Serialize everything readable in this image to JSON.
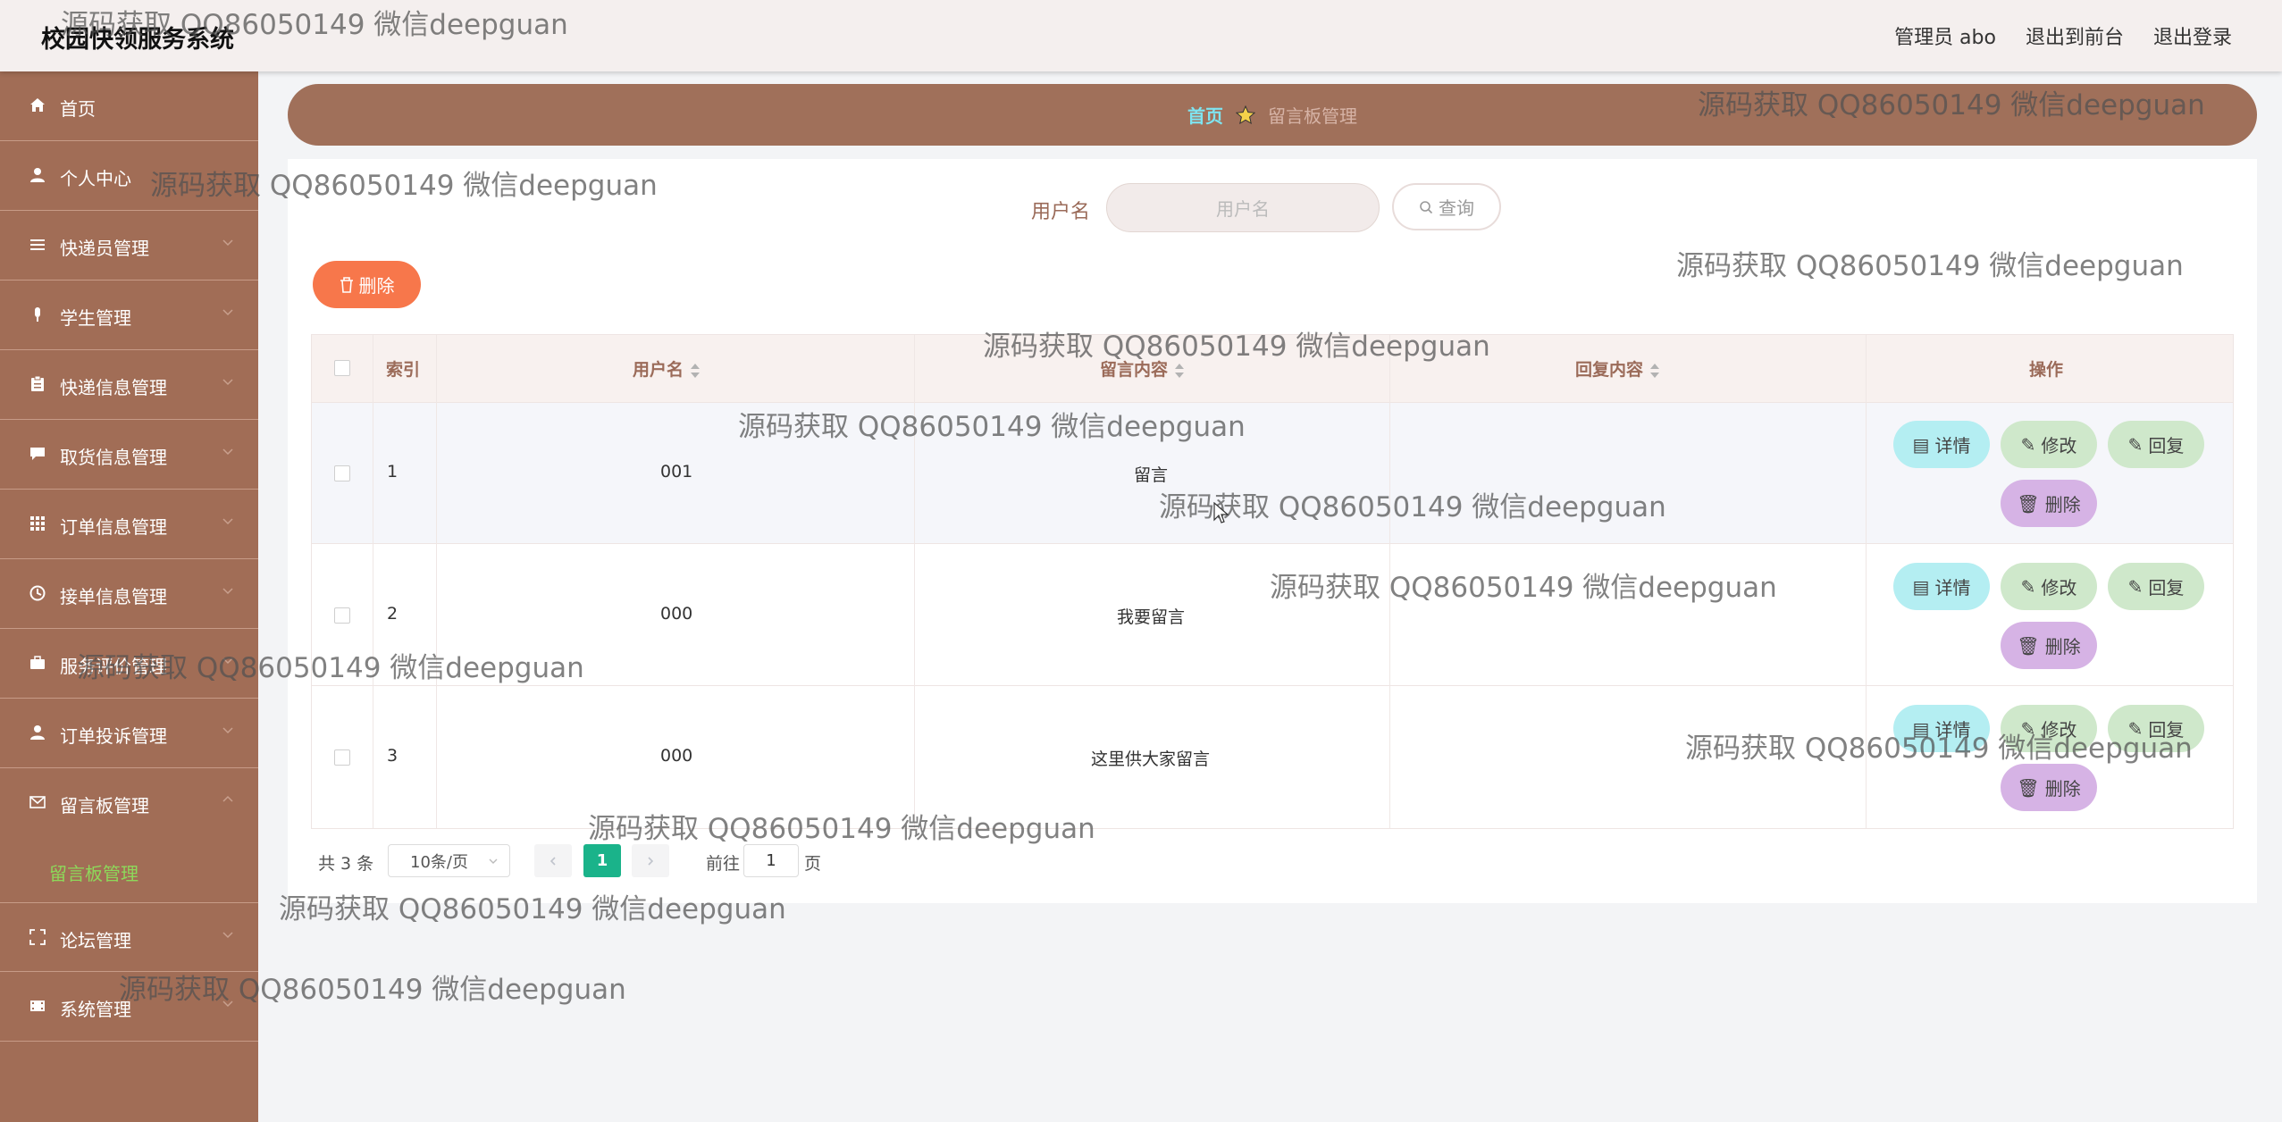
{
  "app": {
    "title": "校园快领服务系统"
  },
  "header": {
    "user": "管理员 abo",
    "to_front": "退出到前台",
    "logout": "退出登录"
  },
  "sidebar": {
    "items": [
      {
        "label": "首页",
        "icon": "home-icon"
      },
      {
        "label": "个人中心",
        "icon": "user-icon"
      },
      {
        "label": "快递员管理",
        "icon": "list-icon"
      },
      {
        "label": "学生管理",
        "icon": "microphone-icon"
      },
      {
        "label": "快递信息管理",
        "icon": "clipboard-icon"
      },
      {
        "label": "取货信息管理",
        "icon": "chat-icon"
      },
      {
        "label": "订单信息管理",
        "icon": "grid-icon"
      },
      {
        "label": "接单信息管理",
        "icon": "clock-icon"
      },
      {
        "label": "服务评价管理",
        "icon": "briefcase-icon"
      },
      {
        "label": "订单投诉管理",
        "icon": "user-icon"
      },
      {
        "label": "留言板管理",
        "icon": "mail-icon"
      },
      {
        "label": "论坛管理",
        "icon": "fullscreen-icon"
      },
      {
        "label": "系统管理",
        "icon": "film-icon"
      }
    ],
    "active_sub": "留言板管理"
  },
  "breadcrumb": {
    "home": "首页",
    "current": "留言板管理"
  },
  "search": {
    "label": "用户名",
    "placeholder": "用户名",
    "button": "查询"
  },
  "bulk": {
    "delete": "删除"
  },
  "table": {
    "headers": {
      "index": "索引",
      "username": "用户名",
      "content": "留言内容",
      "reply": "回复内容",
      "actions": "操作"
    },
    "rows": [
      {
        "index": "1",
        "username": "001",
        "content": "留言",
        "reply": ""
      },
      {
        "index": "2",
        "username": "000",
        "content": "我要留言",
        "reply": ""
      },
      {
        "index": "3",
        "username": "000",
        "content": "这里供大家留言",
        "reply": ""
      }
    ],
    "actions": {
      "detail": "详情",
      "edit": "修改",
      "reply": "回复",
      "delete": "删除"
    }
  },
  "pagination": {
    "total": "共 3 条",
    "page_size": "10条/页",
    "current": "1",
    "goto_prefix": "前往",
    "goto_value": "1",
    "goto_suffix": "页"
  },
  "watermark": "源码获取 QQ86050149 微信deepguan",
  "colors": {
    "sidebar": "#a16d56",
    "accent_green": "#1ab38a",
    "delete_btn": "#f7774b"
  }
}
